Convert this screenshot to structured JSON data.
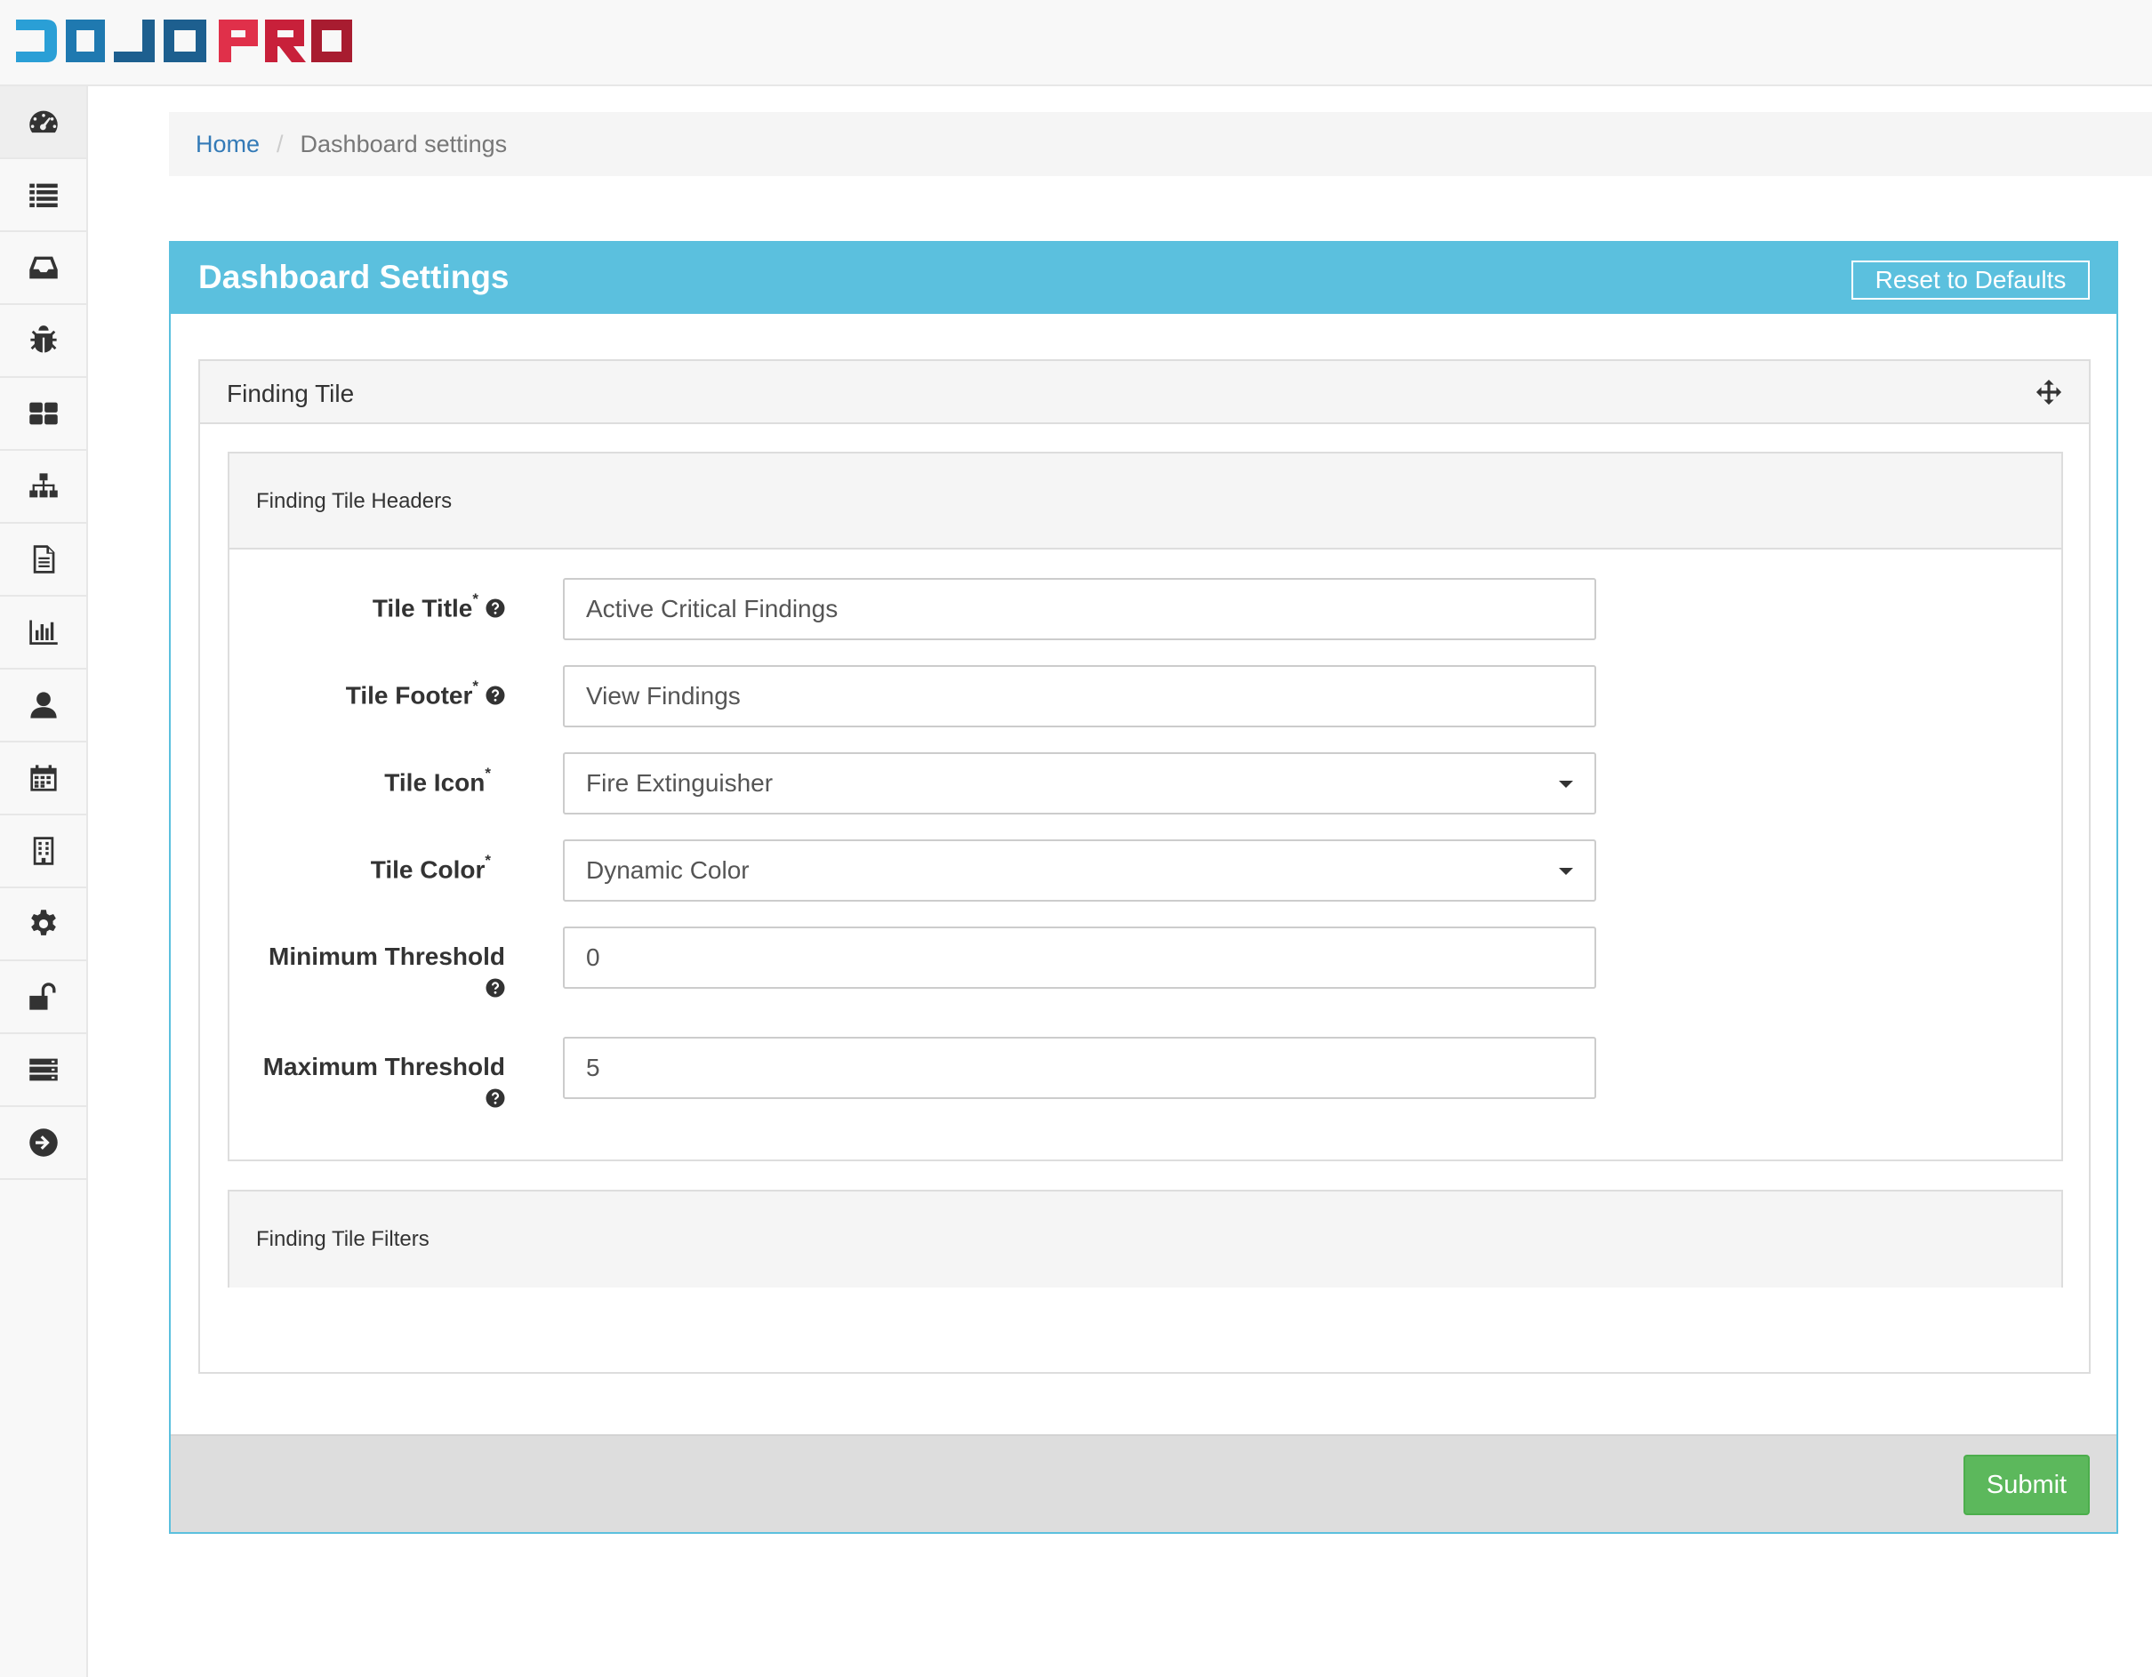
{
  "app": {
    "logo_text": "DOJO PRO",
    "logo_colors": {
      "dojo": "#2a9fd6",
      "pro": "#c0203a"
    }
  },
  "sidebar": {
    "items": [
      {
        "icon": "dashboard-icon",
        "active": true
      },
      {
        "icon": "list-icon"
      },
      {
        "icon": "inbox-icon"
      },
      {
        "icon": "bug-icon"
      },
      {
        "icon": "grid-icon"
      },
      {
        "icon": "sitemap-icon"
      },
      {
        "icon": "document-icon"
      },
      {
        "icon": "bar-chart-icon"
      },
      {
        "icon": "user-icon"
      },
      {
        "icon": "calendar-icon"
      },
      {
        "icon": "building-icon"
      },
      {
        "icon": "gear-icon"
      },
      {
        "icon": "unlock-icon"
      },
      {
        "icon": "server-icon"
      },
      {
        "icon": "arrow-circle-right-icon"
      }
    ]
  },
  "breadcrumb": {
    "home": "Home",
    "separator": "/",
    "current": "Dashboard settings"
  },
  "panel": {
    "title": "Dashboard Settings",
    "reset_label": "Reset to Defaults",
    "accent_color": "#5bc0de"
  },
  "finding_tile": {
    "title": "Finding Tile",
    "headers_title": "Finding Tile Headers",
    "filters_title": "Finding Tile Filters",
    "fields": {
      "tile_title": {
        "label": "Tile Title",
        "required": "*",
        "value": "Active Critical Findings"
      },
      "tile_footer": {
        "label": "Tile Footer",
        "required": "*",
        "value": "View Findings"
      },
      "tile_icon": {
        "label": "Tile Icon",
        "required": "*",
        "value": "Fire Extinguisher"
      },
      "tile_color": {
        "label": "Tile Color",
        "required": "*",
        "value": "Dynamic Color"
      },
      "min_threshold": {
        "label": "Minimum Threshold",
        "value": "0"
      },
      "max_threshold": {
        "label": "Maximum Threshold",
        "value": "5"
      }
    }
  },
  "footer": {
    "submit_label": "Submit",
    "submit_color": "#5cb85c"
  }
}
